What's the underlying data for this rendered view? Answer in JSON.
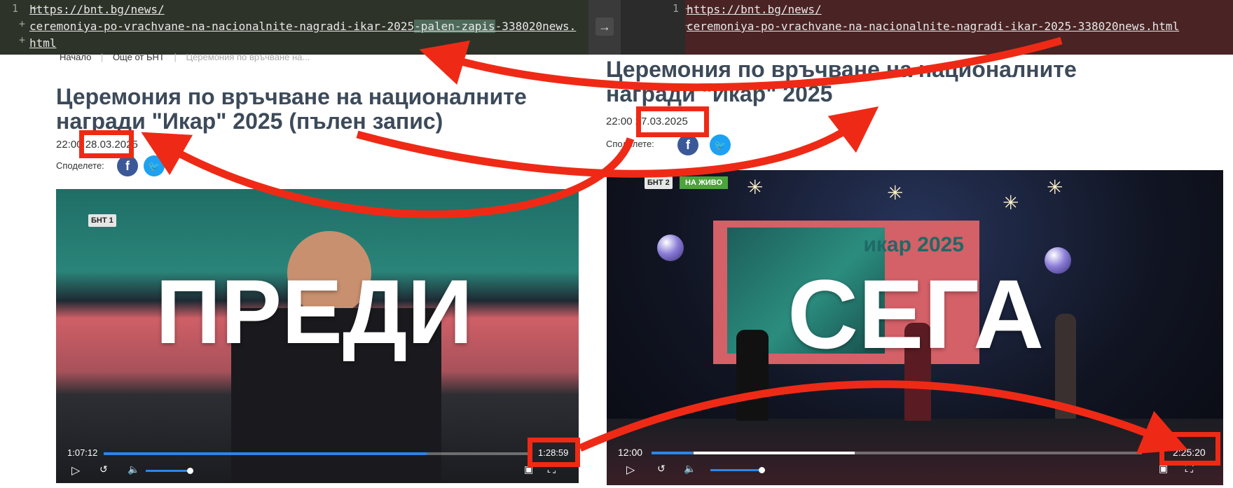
{
  "diff": {
    "left": {
      "line_no": "1",
      "url_line1": "https://bnt.bg/news/",
      "url_part_a": "ceremoniya-po-vrachvane-na-nacionalnite-nagradi-ikar-2025",
      "url_part_added": "-palen-zapis",
      "url_part_b": "-338020news.",
      "url_line3": "html"
    },
    "right": {
      "line_no": "1",
      "url_line1": "https://bnt.bg/news/",
      "url_line2": "ceremoniya-po-vrachvane-na-nacionalnite-nagradi-ikar-2025-338020news.html"
    },
    "arrow": "→"
  },
  "breadcrumb": [
    "Начало",
    "Още от БНТ",
    "Церемония по връчване на..."
  ],
  "left_article": {
    "title_line1": "Церемония по връчване на националните",
    "title_line2": "награди \"Икар\" 2025 (пълен запис)",
    "time": "22:00",
    "date": "28.03.2025",
    "share_label": "Споделете:"
  },
  "right_article": {
    "title_line1": "Церемония по връчване на националните",
    "title_line2": "награди \"Икар\" 2025",
    "time": "22:00",
    "date": "27.03.2025",
    "share_label": "Споделете:"
  },
  "left_video": {
    "overlay_word": "ПРЕДИ",
    "logo": "БНТ 1",
    "current_time": "1:07:12",
    "duration": "1:28:59",
    "progress": 0.7553
  },
  "right_video": {
    "overlay_word": "СЕГА",
    "logo": "БНТ 2",
    "live_badge": "НА ЖИВО",
    "stage_text": "икар 2025",
    "current_time": "12:00",
    "duration": "2:25:20",
    "progress": 0.0826
  },
  "colors": {
    "annotation_red": "#ee2a16",
    "progress_blue": "#2a86e8",
    "title": "#3c4a5a"
  }
}
